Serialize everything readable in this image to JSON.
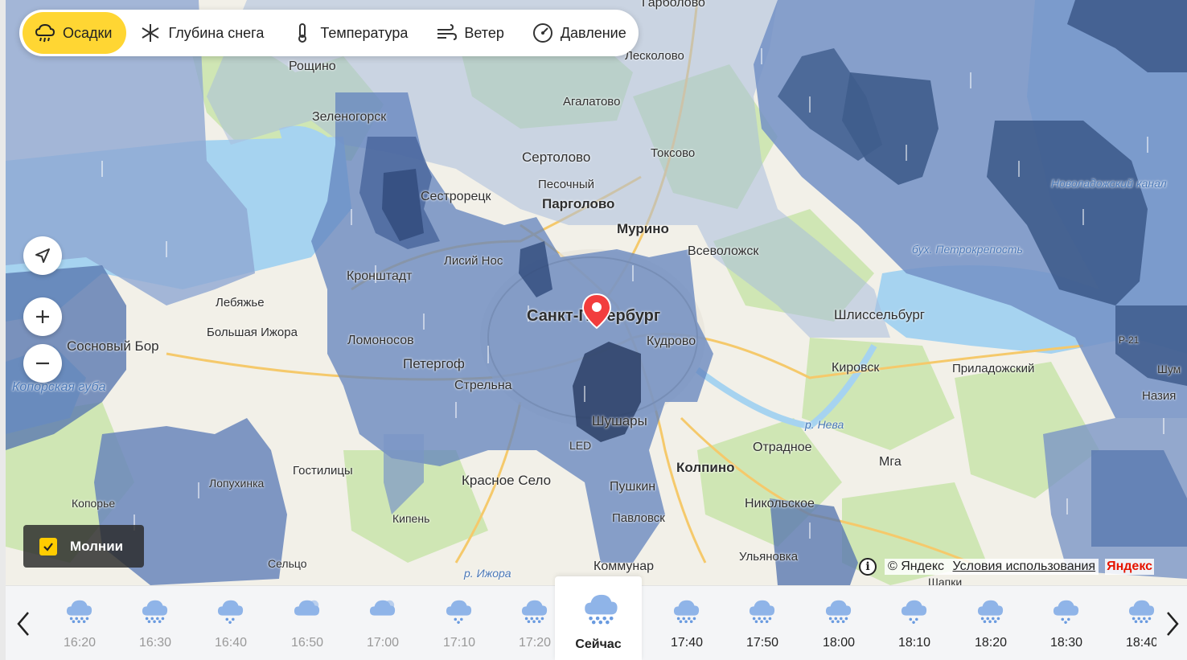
{
  "layers": [
    {
      "label": "Осадки",
      "icon": "rain-cloud-icon",
      "active": true
    },
    {
      "label": "Глубина снега",
      "icon": "snowflake-icon",
      "active": false
    },
    {
      "label": "Температура",
      "icon": "thermometer-icon",
      "active": false
    },
    {
      "label": "Ветер",
      "icon": "wind-icon",
      "active": false
    },
    {
      "label": "Давление",
      "icon": "pressure-gauge-icon",
      "active": false
    }
  ],
  "controls": {
    "locate_icon": "locate-arrow-icon",
    "zoom_in_icon": "plus-icon",
    "zoom_out_icon": "minus-icon"
  },
  "lightning": {
    "label": "Молнии",
    "checked": true
  },
  "attribution": {
    "copyright": "© Яндекс",
    "terms": "Условия использования",
    "brand": "Яндекс"
  },
  "map": {
    "marker": "location-pin-icon",
    "places": [
      {
        "name": "Гарболово"
      },
      {
        "name": "Рощино"
      },
      {
        "name": "Лесколово"
      },
      {
        "name": "Агалатово"
      },
      {
        "name": "Зеленогорск"
      },
      {
        "name": "Сертолово"
      },
      {
        "name": "Токсово"
      },
      {
        "name": "Песочный"
      },
      {
        "name": "Сестрорецк"
      },
      {
        "name": "Парголово"
      },
      {
        "name": "Мурино"
      },
      {
        "name": "Всеволожск"
      },
      {
        "name": "Лисий Нос"
      },
      {
        "name": "Кронштадт"
      },
      {
        "name": "Лебяжье"
      },
      {
        "name": "Санкт-Петербург"
      },
      {
        "name": "Шлиссельбург"
      },
      {
        "name": "Большая Ижора"
      },
      {
        "name": "Сосновый Бор"
      },
      {
        "name": "Ломоносов"
      },
      {
        "name": "Кудрово"
      },
      {
        "name": "Петергоф"
      },
      {
        "name": "Кировск"
      },
      {
        "name": "Приладожский"
      },
      {
        "name": "Стрельна"
      },
      {
        "name": "Копорская губа"
      },
      {
        "name": "Назия"
      },
      {
        "name": "Шушары"
      },
      {
        "name": "LED"
      },
      {
        "name": "р. Нева"
      },
      {
        "name": "Отрадное"
      },
      {
        "name": "Колпино"
      },
      {
        "name": "Гостилицы"
      },
      {
        "name": "Мга"
      },
      {
        "name": "Лопухинка"
      },
      {
        "name": "Красное Село"
      },
      {
        "name": "Пушкин"
      },
      {
        "name": "Копорье"
      },
      {
        "name": "Никольское"
      },
      {
        "name": "Кипень"
      },
      {
        "name": "Павловск"
      },
      {
        "name": "Ульяновка"
      },
      {
        "name": "Сельцо"
      },
      {
        "name": "Коммунар"
      },
      {
        "name": "р. Ижора"
      },
      {
        "name": "Шапки"
      },
      {
        "name": "бух. Петрокрепость"
      },
      {
        "name": "Новоладожский канал"
      },
      {
        "name": "Шум"
      },
      {
        "name": "Р-21"
      }
    ]
  },
  "timeline": {
    "prev_icon": "chevron-left-icon",
    "next_icon": "chevron-right-icon",
    "items": [
      {
        "time": "16:20",
        "icon": "rain-cloud-icon",
        "state": "past"
      },
      {
        "time": "16:30",
        "icon": "rain-cloud-icon",
        "state": "past"
      },
      {
        "time": "16:40",
        "icon": "light-rain-cloud-icon",
        "state": "past"
      },
      {
        "time": "16:50",
        "icon": "cloud-icon",
        "state": "past"
      },
      {
        "time": "17:00",
        "icon": "cloud-icon",
        "state": "past"
      },
      {
        "time": "17:10",
        "icon": "light-rain-cloud-icon",
        "state": "past"
      },
      {
        "time": "17:20",
        "icon": "rain-cloud-icon",
        "state": "past"
      },
      {
        "time": "Сейчас",
        "icon": "rain-cloud-icon",
        "state": "current"
      },
      {
        "time": "17:40",
        "icon": "rain-cloud-icon",
        "state": "future"
      },
      {
        "time": "17:50",
        "icon": "rain-cloud-icon",
        "state": "future"
      },
      {
        "time": "18:00",
        "icon": "rain-cloud-icon",
        "state": "future"
      },
      {
        "time": "18:10",
        "icon": "light-rain-cloud-icon",
        "state": "future"
      },
      {
        "time": "18:20",
        "icon": "rain-cloud-icon",
        "state": "future"
      },
      {
        "time": "18:30",
        "icon": "light-rain-cloud-icon",
        "state": "future"
      },
      {
        "time": "18:40",
        "icon": "rain-cloud-icon",
        "state": "future"
      }
    ]
  },
  "colors": {
    "active_tab": "#ffd633",
    "precip_light": "#9eb4d6",
    "precip_medium": "#6a88bd",
    "precip_heavy": "#45608f",
    "marker": "#f23d3d",
    "water": "#a6d3f0",
    "land": "#f2f0e8",
    "forest": "#cfe6b4",
    "checkbox": "#ffcc00"
  }
}
